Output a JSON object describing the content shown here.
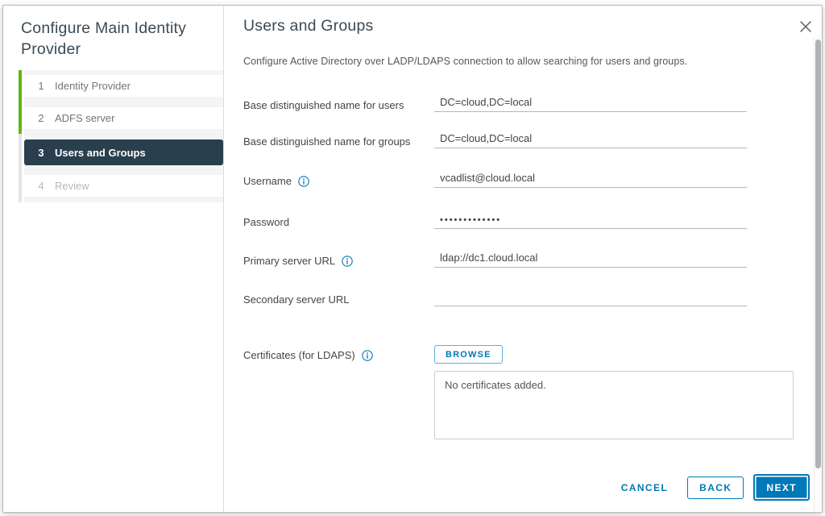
{
  "colors": {
    "accent_blue": "#0079b8",
    "progress_green": "#61b715",
    "active_step_bg": "#2a3f4d",
    "text_dark": "#3c4a54",
    "text_body": "#565656"
  },
  "wizard": {
    "title": "Configure Main Identity Provider",
    "steps": [
      {
        "number": "1",
        "label": "Identity Provider",
        "state": "completed"
      },
      {
        "number": "2",
        "label": "ADFS server",
        "state": "completed"
      },
      {
        "number": "3",
        "label": "Users and Groups",
        "state": "current"
      },
      {
        "number": "4",
        "label": "Review",
        "state": "disabled"
      }
    ]
  },
  "page": {
    "title": "Users and Groups",
    "description": "Configure Active Directory over LADP/LDAPS connection to allow searching for users and groups.",
    "fields": [
      {
        "label": "Base distinguished name for users",
        "value": "DC=cloud,DC=local"
      },
      {
        "label": "Base distinguished name for groups",
        "value": "DC=cloud,DC=local"
      },
      {
        "label": "Username",
        "value": "vcadlist@cloud.local"
      },
      {
        "label": "Password",
        "value": "•••••••••••••"
      },
      {
        "label": "Primary server URL",
        "value": "ldap://dc1.cloud.local"
      },
      {
        "label": "Secondary server URL",
        "value": ""
      }
    ],
    "certificates": {
      "label": "Certificates (for LDAPS)",
      "browse_label": "BROWSE",
      "empty_text": "No certificates added."
    }
  },
  "footer": {
    "cancel_label": "CANCEL",
    "back_label": "BACK",
    "next_label": "NEXT"
  }
}
